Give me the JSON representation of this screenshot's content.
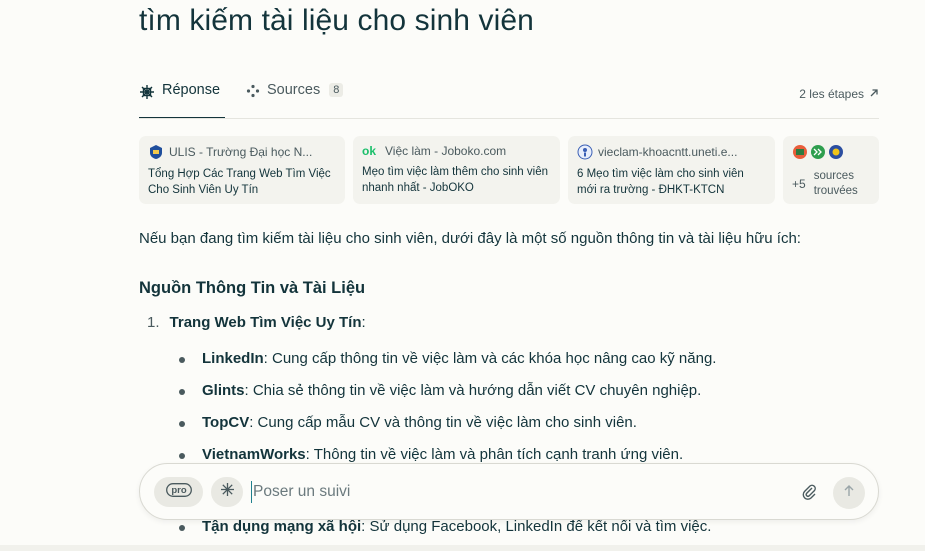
{
  "query": "tìm kiếm tài liệu cho sinh viên",
  "tabs": {
    "answer": "Réponse",
    "sources": "Sources",
    "sources_count": "8",
    "steps": "2 les étapes"
  },
  "sources": [
    {
      "site": "ULIS - Trường Đại học N...",
      "title": "Tổng Hợp Các Trang Web Tìm Việc Cho Sinh Viên Uy Tín",
      "icon": "ulis-icon"
    },
    {
      "site": "Việc làm - Joboko.com",
      "title": "Mẹo tìm việc làm thêm cho sinh viên nhanh nhất - JobOKO",
      "icon": "joboko-icon"
    },
    {
      "site": "vieclam-khoacntt.uneti.e...",
      "title": "6 Mẹo tìm việc làm cho sinh viên mới ra trường - ĐHKT-KTCN",
      "icon": "uneti-icon"
    }
  ],
  "more_sources": {
    "count": "+5",
    "label": "sources trouvées"
  },
  "answer": {
    "intro": "Nếu bạn đang tìm kiếm tài liệu cho sinh viên, dưới đây là một số nguồn thông tin và tài liệu hữu ích:",
    "heading": "Nguồn Thông Tin và Tài Liệu",
    "list_number": "1.",
    "list_label": "Trang Web Tìm Việc Uy Tín",
    "list_colon": ":",
    "bullets": [
      {
        "name": "LinkedIn",
        "text": ": Cung cấp thông tin về việc làm và các khóa học nâng cao kỹ năng."
      },
      {
        "name": "Glints",
        "text": ": Chia sẻ thông tin về việc làm và hướng dẫn viết CV chuyên nghiệp."
      },
      {
        "name": "TopCV",
        "text": ": Cung cấp mẫu CV và thông tin về việc làm cho sinh viên."
      },
      {
        "name": "VietnamWorks",
        "text": ": Thông tin về việc làm và phân tích cạnh tranh ứng viên."
      },
      {
        "name": "Tận dụng mạng xã hội",
        "text": ": Sử dụng Facebook, LinkedIn để kết nối và tìm việc."
      }
    ]
  },
  "followup": {
    "placeholder": "Poser un suivi",
    "pro_label": "pro"
  },
  "colors": {
    "accent": "#20808d",
    "text": "#13343b",
    "muted": "#4a5a5e",
    "card": "#f3f3ee",
    "background": "#fcfcf9"
  }
}
